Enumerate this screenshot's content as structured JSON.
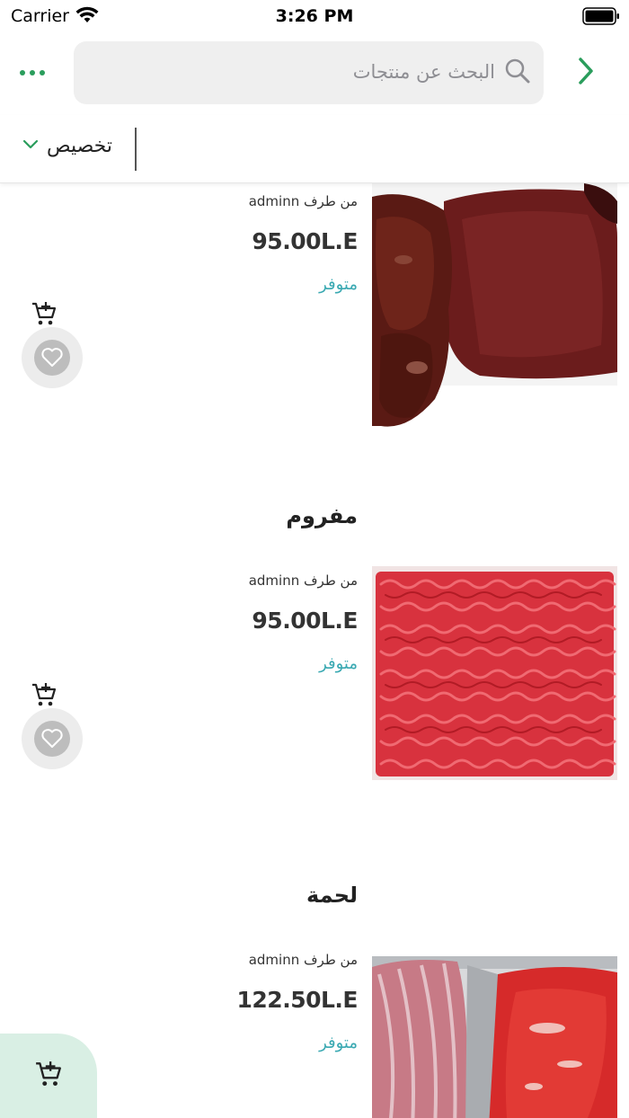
{
  "status_bar": {
    "carrier": "Carrier",
    "time": "3:26 PM"
  },
  "header": {
    "search_placeholder": "البحث عن منتجات"
  },
  "filter": {
    "sort_label": "تخصيص"
  },
  "colors": {
    "accent": "#2a9d5c",
    "stock": "#3aa9b2",
    "search_bg": "#efefef",
    "float_bg": "#d9efe4"
  },
  "products": [
    {
      "title": "",
      "vendor": "من طرف adminn",
      "price": "95.00L.E",
      "stock": "متوفر",
      "image": "liver-image"
    },
    {
      "title": "مفروم",
      "vendor": "من طرف adminn",
      "price": "95.00L.E",
      "stock": "متوفر",
      "image": "minced-meat-image"
    },
    {
      "title": "لحمة",
      "vendor": "من طرف adminn",
      "price": "122.50L.E",
      "stock": "متوفر",
      "image": "beef-image"
    }
  ]
}
